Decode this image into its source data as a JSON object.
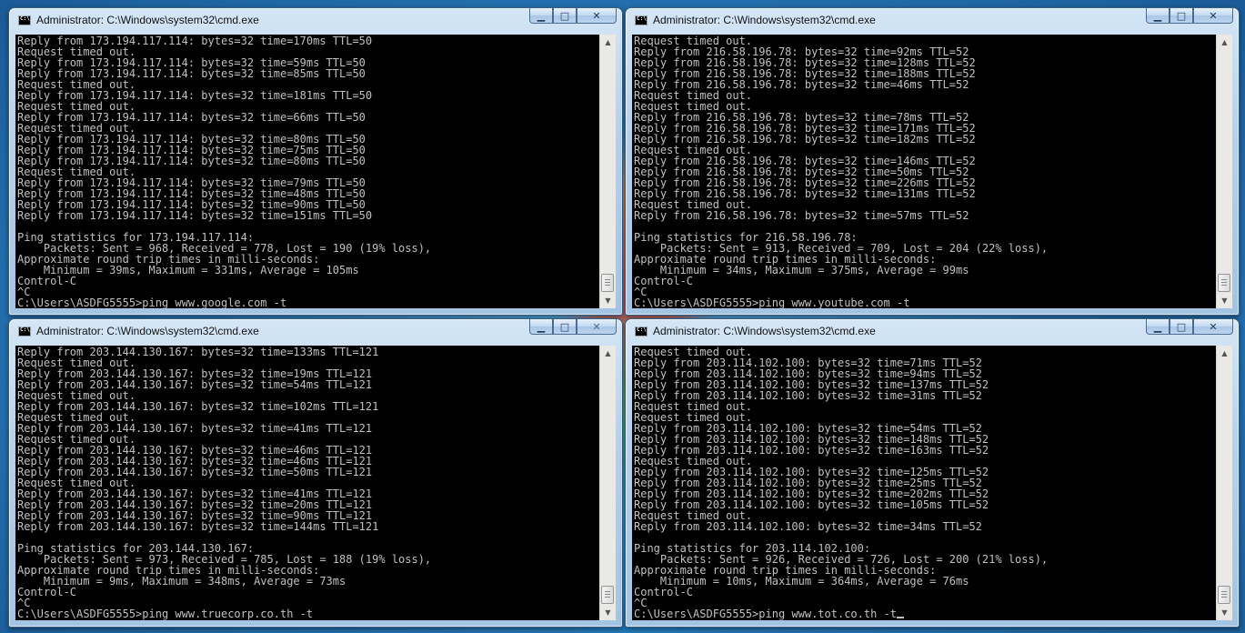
{
  "windows": [
    {
      "title": "Administrator: C:\\Windows\\system32\\cmd.exe",
      "lines": [
        "Reply from 173.194.117.114: bytes=32 time=170ms TTL=50",
        "Request timed out.",
        "Reply from 173.194.117.114: bytes=32 time=59ms TTL=50",
        "Reply from 173.194.117.114: bytes=32 time=85ms TTL=50",
        "Request timed out.",
        "Reply from 173.194.117.114: bytes=32 time=181ms TTL=50",
        "Request timed out.",
        "Reply from 173.194.117.114: bytes=32 time=66ms TTL=50",
        "Request timed out.",
        "Reply from 173.194.117.114: bytes=32 time=80ms TTL=50",
        "Reply from 173.194.117.114: bytes=32 time=75ms TTL=50",
        "Reply from 173.194.117.114: bytes=32 time=80ms TTL=50",
        "Request timed out.",
        "Reply from 173.194.117.114: bytes=32 time=79ms TTL=50",
        "Reply from 173.194.117.114: bytes=32 time=48ms TTL=50",
        "Reply from 173.194.117.114: bytes=32 time=90ms TTL=50",
        "Reply from 173.194.117.114: bytes=32 time=151ms TTL=50",
        "",
        "Ping statistics for 173.194.117.114:",
        "    Packets: Sent = 968, Received = 778, Lost = 190 (19% loss),",
        "Approximate round trip times in milli-seconds:",
        "    Minimum = 39ms, Maximum = 331ms, Average = 105ms",
        "Control-C",
        "^C",
        "C:\\Users\\ASDFG5555>ping www.google.com -t"
      ],
      "show_cursor": false
    },
    {
      "title": "Administrator: C:\\Windows\\system32\\cmd.exe",
      "lines": [
        "Request timed out.",
        "Reply from 216.58.196.78: bytes=32 time=92ms TTL=52",
        "Reply from 216.58.196.78: bytes=32 time=128ms TTL=52",
        "Reply from 216.58.196.78: bytes=32 time=188ms TTL=52",
        "Reply from 216.58.196.78: bytes=32 time=46ms TTL=52",
        "Request timed out.",
        "Request timed out.",
        "Reply from 216.58.196.78: bytes=32 time=78ms TTL=52",
        "Reply from 216.58.196.78: bytes=32 time=171ms TTL=52",
        "Reply from 216.58.196.78: bytes=32 time=182ms TTL=52",
        "Request timed out.",
        "Reply from 216.58.196.78: bytes=32 time=146ms TTL=52",
        "Reply from 216.58.196.78: bytes=32 time=50ms TTL=52",
        "Reply from 216.58.196.78: bytes=32 time=226ms TTL=52",
        "Reply from 216.58.196.78: bytes=32 time=131ms TTL=52",
        "Request timed out.",
        "Reply from 216.58.196.78: bytes=32 time=57ms TTL=52",
        "",
        "Ping statistics for 216.58.196.78:",
        "    Packets: Sent = 913, Received = 709, Lost = 204 (22% loss),",
        "Approximate round trip times in milli-seconds:",
        "    Minimum = 34ms, Maximum = 375ms, Average = 99ms",
        "Control-C",
        "^C",
        "C:\\Users\\ASDFG5555>ping www.youtube.com -t"
      ],
      "show_cursor": false
    },
    {
      "title": "Administrator: C:\\Windows\\system32\\cmd.exe",
      "lines": [
        "Reply from 203.144.130.167: bytes=32 time=133ms TTL=121",
        "Request timed out.",
        "Reply from 203.144.130.167: bytes=32 time=19ms TTL=121",
        "Reply from 203.144.130.167: bytes=32 time=54ms TTL=121",
        "Request timed out.",
        "Reply from 203.144.130.167: bytes=32 time=102ms TTL=121",
        "Request timed out.",
        "Reply from 203.144.130.167: bytes=32 time=41ms TTL=121",
        "Request timed out.",
        "Reply from 203.144.130.167: bytes=32 time=46ms TTL=121",
        "Reply from 203.144.130.167: bytes=32 time=46ms TTL=121",
        "Reply from 203.144.130.167: bytes=32 time=50ms TTL=121",
        "Request timed out.",
        "Reply from 203.144.130.167: bytes=32 time=41ms TTL=121",
        "Reply from 203.144.130.167: bytes=32 time=20ms TTL=121",
        "Reply from 203.144.130.167: bytes=32 time=90ms TTL=121",
        "Reply from 203.144.130.167: bytes=32 time=144ms TTL=121",
        "",
        "Ping statistics for 203.144.130.167:",
        "    Packets: Sent = 973, Received = 785, Lost = 188 (19% loss),",
        "Approximate round trip times in milli-seconds:",
        "    Minimum = 9ms, Maximum = 348ms, Average = 73ms",
        "Control-C",
        "^C",
        "C:\\Users\\ASDFG5555>ping www.truecorp.co.th -t"
      ],
      "show_cursor": false
    },
    {
      "title": "Administrator: C:\\Windows\\system32\\cmd.exe",
      "lines": [
        "Request timed out.",
        "Reply from 203.114.102.100: bytes=32 time=71ms TTL=52",
        "Reply from 203.114.102.100: bytes=32 time=94ms TTL=52",
        "Reply from 203.114.102.100: bytes=32 time=137ms TTL=52",
        "Reply from 203.114.102.100: bytes=32 time=31ms TTL=52",
        "Request timed out.",
        "Request timed out.",
        "Reply from 203.114.102.100: bytes=32 time=54ms TTL=52",
        "Reply from 203.114.102.100: bytes=32 time=148ms TTL=52",
        "Reply from 203.114.102.100: bytes=32 time=163ms TTL=52",
        "Request timed out.",
        "Reply from 203.114.102.100: bytes=32 time=125ms TTL=52",
        "Reply from 203.114.102.100: bytes=32 time=25ms TTL=52",
        "Reply from 203.114.102.100: bytes=32 time=202ms TTL=52",
        "Reply from 203.114.102.100: bytes=32 time=105ms TTL=52",
        "Request timed out.",
        "Reply from 203.114.102.100: bytes=32 time=34ms TTL=52",
        "",
        "Ping statistics for 203.114.102.100:",
        "    Packets: Sent = 926, Received = 726, Lost = 200 (21% loss),",
        "Approximate round trip times in milli-seconds:",
        "    Minimum = 10ms, Maximum = 364ms, Average = 76ms",
        "Control-C",
        "^C",
        "C:\\Users\\ASDFG5555>ping www.tot.co.th -t"
      ],
      "show_cursor": true
    }
  ],
  "controls": {
    "minimize": "▁",
    "maximize": "□",
    "close": "✕"
  }
}
